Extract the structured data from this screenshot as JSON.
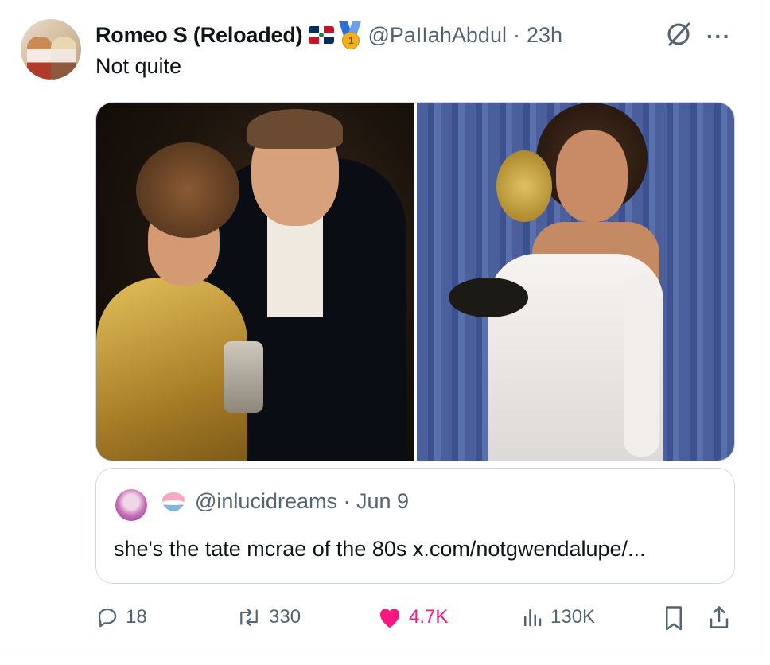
{
  "tweet": {
    "author_name": "Romeo S (Reloaded)",
    "handle": "@PaIIahAbdul",
    "separator": "·",
    "time": "23h",
    "text": "Not quite",
    "medal_number": "1"
  },
  "quote": {
    "handle": "@inlucidreams",
    "separator": "·",
    "date": "Jun 9",
    "text": "she's the tate mcrae of the 80s x.com/notgwendalupe/..."
  },
  "actions": {
    "replies": "18",
    "reposts": "330",
    "likes": "4.7K",
    "views": "130K"
  },
  "colors": {
    "like": "#f91880",
    "muted": "#536471",
    "text": "#0f1419"
  }
}
